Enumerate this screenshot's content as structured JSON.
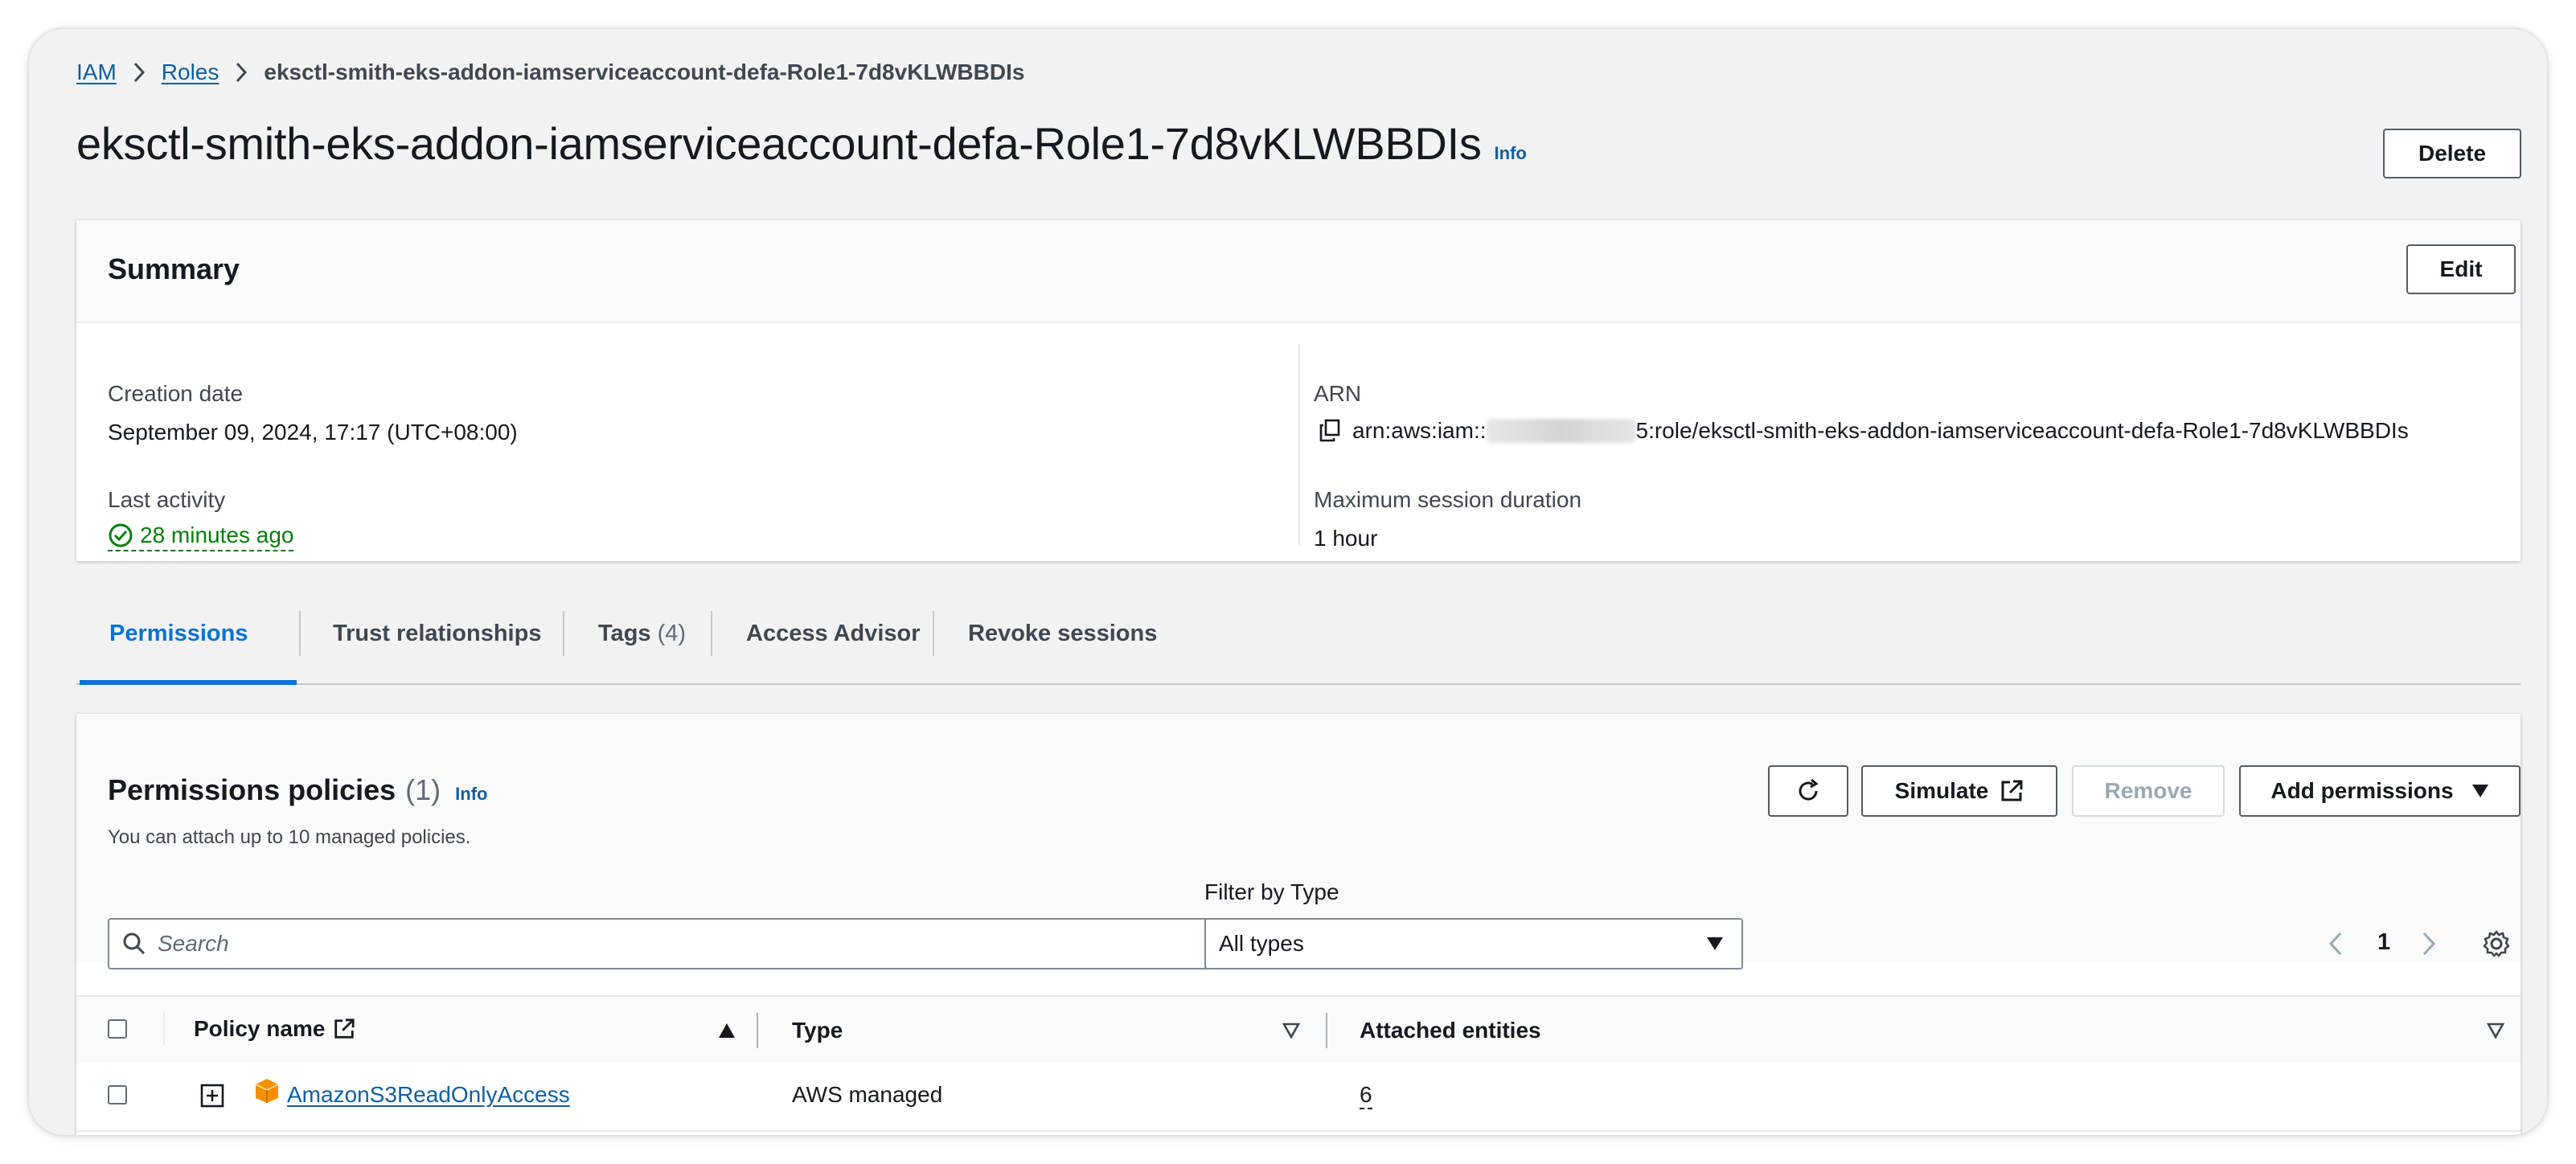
{
  "breadcrumb": {
    "items": [
      "IAM",
      "Roles"
    ],
    "current": "eksctl-smith-eks-addon-iamserviceaccount-defa-Role1-7d8vKLWBBDIs"
  },
  "page": {
    "title": "eksctl-smith-eks-addon-iamserviceaccount-defa-Role1-7d8vKLWBBDIs",
    "info_label": "Info",
    "delete_label": "Delete"
  },
  "summary": {
    "heading": "Summary",
    "edit_label": "Edit",
    "creation_date_label": "Creation date",
    "creation_date_value": "September 09, 2024, 17:17 (UTC+08:00)",
    "last_activity_label": "Last activity",
    "last_activity_value": "28 minutes ago",
    "arn_label": "ARN",
    "arn_prefix": "arn:aws:iam::",
    "arn_suffix": "5:role/eksctl-smith-eks-addon-iamserviceaccount-defa-Role1-7d8vKLWBBDIs",
    "max_session_label": "Maximum session duration",
    "max_session_value": "1 hour"
  },
  "tabs": [
    {
      "label": "Permissions",
      "count": ""
    },
    {
      "label": "Trust relationships",
      "count": ""
    },
    {
      "label": "Tags",
      "count": "(4)"
    },
    {
      "label": "Access Advisor",
      "count": ""
    },
    {
      "label": "Revoke sessions",
      "count": ""
    }
  ],
  "permissions": {
    "heading": "Permissions policies",
    "count": "(1)",
    "info_label": "Info",
    "description": "You can attach up to 10 managed policies.",
    "simulate_label": "Simulate",
    "remove_label": "Remove",
    "add_permissions_label": "Add permissions",
    "filter_label": "Filter by Type",
    "filter_value": "All types",
    "search_placeholder": "Search",
    "page_number": "1",
    "columns": [
      "Policy name",
      "Type",
      "Attached entities"
    ],
    "rows": [
      {
        "name": "AmazonS3ReadOnlyAccess",
        "type": "AWS managed",
        "attached": "6"
      }
    ]
  },
  "colors": {
    "link": "#0f5f9e",
    "success": "#037f0c",
    "active_tab": "#0972d3"
  }
}
